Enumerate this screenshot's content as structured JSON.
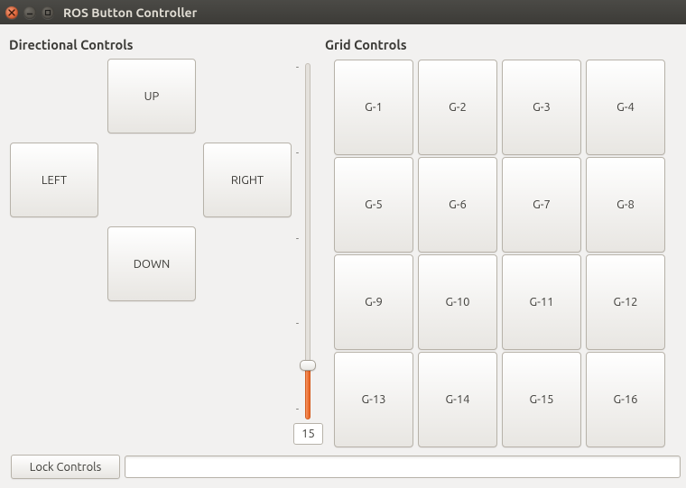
{
  "window": {
    "title": "ROS Button Controller"
  },
  "sections": {
    "directional_label": "Directional Controls",
    "grid_label": "Grid Controls"
  },
  "dpad": {
    "up": "UP",
    "down": "DOWN",
    "left": "LEFT",
    "right": "RIGHT"
  },
  "slider": {
    "min": 0,
    "max": 100,
    "value": 15,
    "value_display": "15",
    "ticks": [
      "-",
      "-",
      "-",
      "-",
      "-"
    ]
  },
  "grid": {
    "labels": [
      "G-1",
      "G-2",
      "G-3",
      "G-4",
      "G-5",
      "G-6",
      "G-7",
      "G-8",
      "G-9",
      "G-10",
      "G-11",
      "G-12",
      "G-13",
      "G-14",
      "G-15",
      "G-16"
    ]
  },
  "bottom": {
    "lock_label": "Lock Controls",
    "input_value": ""
  }
}
